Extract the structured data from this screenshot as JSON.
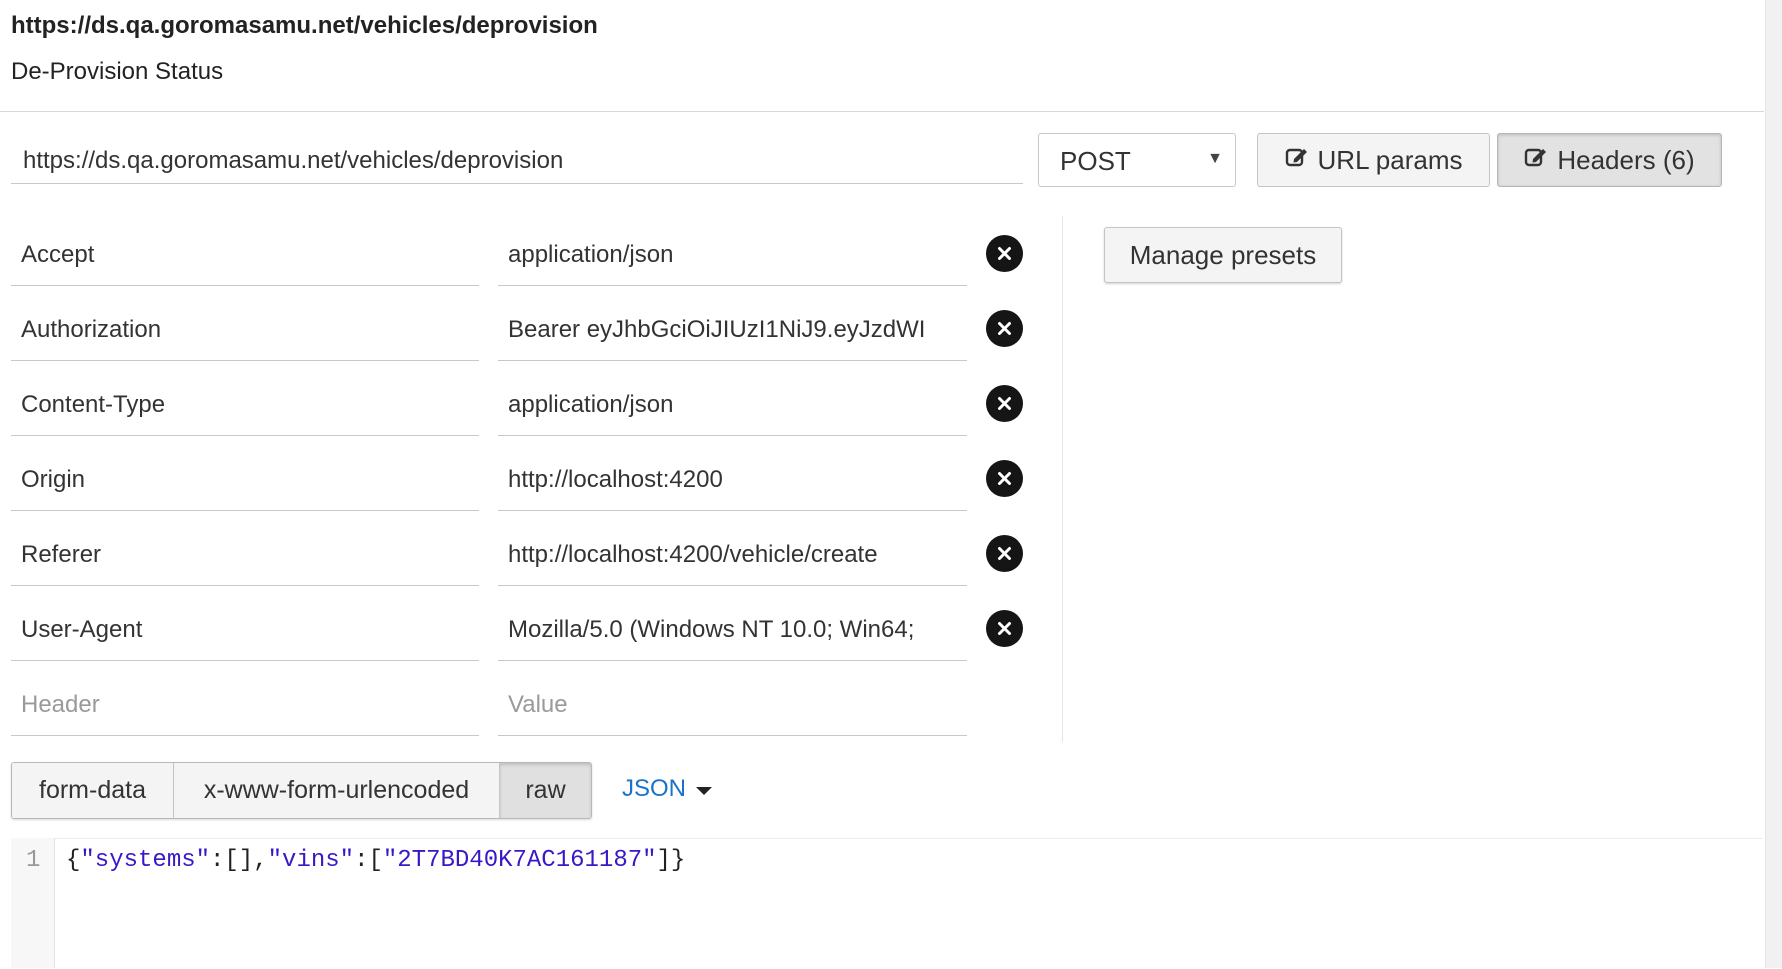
{
  "request": {
    "title_url": "https://ds.qa.goromasamu.net/vehicles/deprovision",
    "name": "De-Provision Status",
    "url": "https://ds.qa.goromasamu.net/vehicles/deprovision",
    "method": "POST"
  },
  "buttons": {
    "url_params": "URL params",
    "headers": "Headers (6)",
    "manage_presets": "Manage presets"
  },
  "icons": {
    "edit": "edit-icon",
    "remove": "remove-circle-icon",
    "caret": "caret-down-icon"
  },
  "headers": [
    {
      "key": "Accept",
      "value": "application/json"
    },
    {
      "key": "Authorization",
      "value": "Bearer eyJhbGciOiJIUzI1NiJ9.eyJzdWI"
    },
    {
      "key": "Content-Type",
      "value": "application/json"
    },
    {
      "key": "Origin",
      "value": "http://localhost:4200"
    },
    {
      "key": "Referer",
      "value": "http://localhost:4200/vehicle/create"
    },
    {
      "key": "User-Agent",
      "value": "Mozilla/5.0 (Windows NT 10.0; Win64;"
    }
  ],
  "new_header": {
    "key_placeholder": "Header",
    "value_placeholder": "Value"
  },
  "body_tabs": [
    "form-data",
    "x-www-form-urlencoded",
    "raw"
  ],
  "active_body_tab": "raw",
  "format": "JSON",
  "editor": {
    "line_number": "1",
    "tokens": [
      "{",
      "\"systems\"",
      ":[],",
      "\"vins\"",
      ":[",
      "\"2T7BD40K7AC161187\"",
      "]}"
    ]
  },
  "colors": {
    "link": "#1a73c8",
    "string": "#3a17c8",
    "icon": "#151515"
  }
}
